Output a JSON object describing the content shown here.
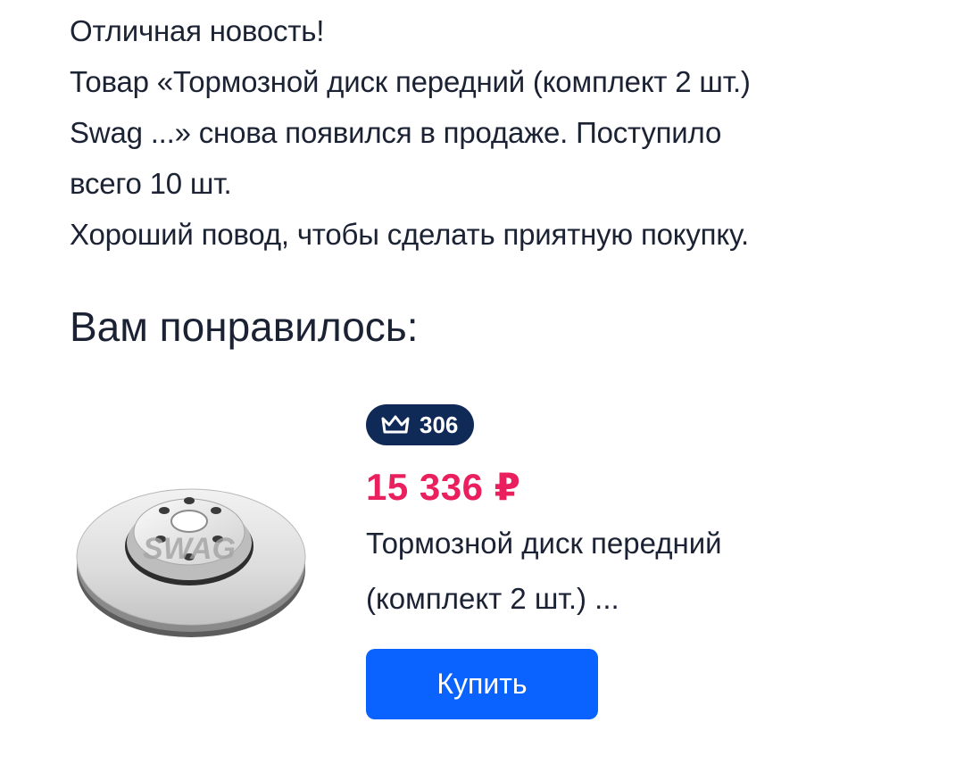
{
  "message": {
    "line1": "Отличная новость!",
    "line2": "Товар «Тормозной диск передний (комплект 2 шт.)",
    "line3": "Swag ...» снова появился в продаже. Поступило",
    "line4": "всего 10 шт.",
    "line5": "Хороший повод, чтобы сделать приятную покупку."
  },
  "section_title": "Вам понравилось:",
  "product": {
    "image_brand": "SWAG",
    "image_icon": "brake-disc-image",
    "badge_icon": "crown-icon",
    "badge_count": "306",
    "price": "15 336 ₽",
    "name_line1": "Тормозной диск передний",
    "name_line2": "(комплект 2 шт.) ...",
    "buy_label": "Купить"
  },
  "colors": {
    "text": "#1b2233",
    "badge_bg": "#0f2a57",
    "price": "#ea1f5e",
    "button": "#0a62ff"
  }
}
